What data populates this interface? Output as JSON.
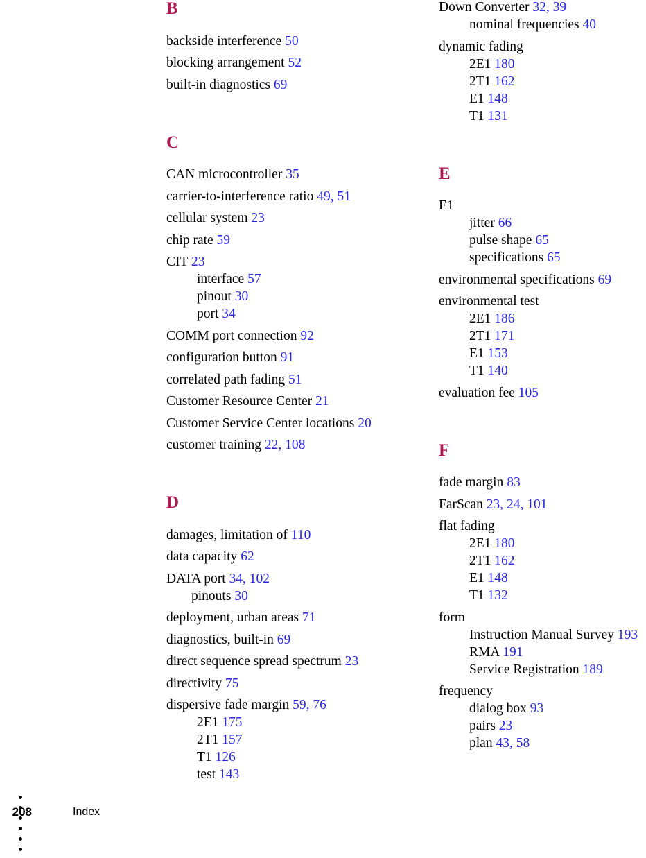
{
  "colors": {
    "letter_heading": "#AF1B53",
    "page_reference": "#2A28E2",
    "entry_text": "#000000",
    "background": "#FFFFFF"
  },
  "footer": {
    "page_number": "208",
    "section_label": "Index",
    "dot_count": 6
  },
  "columns": [
    {
      "id": "left",
      "sections": [
        {
          "letter": "B",
          "entries": [
            {
              "level": 0,
              "term": "backside interference",
              "pages": "50"
            },
            {
              "level": 0,
              "term": "blocking arrangement",
              "pages": "52"
            },
            {
              "level": 0,
              "term": "built-in diagnostics",
              "pages": "69"
            }
          ]
        },
        {
          "letter": "C",
          "entries": [
            {
              "level": 0,
              "term": "CAN microcontroller",
              "pages": "35"
            },
            {
              "level": 0,
              "term": "carrier-to-interference ratio",
              "pages": "49, 51"
            },
            {
              "level": 0,
              "term": "cellular system",
              "pages": "23"
            },
            {
              "level": 0,
              "term": "chip rate",
              "pages": "59"
            },
            {
              "level": 0,
              "term": "CIT",
              "pages": "23"
            },
            {
              "level": 1,
              "term": "interface",
              "pages": "57"
            },
            {
              "level": 1,
              "term": "pinout",
              "pages": "30"
            },
            {
              "level": 1,
              "term": "port",
              "pages": "34"
            },
            {
              "level": 0,
              "term": "COMM port connection",
              "pages": "92"
            },
            {
              "level": 0,
              "term": "configuration button",
              "pages": "91"
            },
            {
              "level": 0,
              "term": "correlated path fading",
              "pages": "51"
            },
            {
              "level": 0,
              "term": "Customer Resource Center",
              "pages": "21"
            },
            {
              "level": 0,
              "term": "Customer Service Center locations",
              "pages": "20"
            },
            {
              "level": 0,
              "term": "customer training",
              "pages": "22, 108"
            }
          ]
        },
        {
          "letter": "D",
          "entries": [
            {
              "level": 0,
              "term": "damages, limitation of",
              "pages": "110"
            },
            {
              "level": 0,
              "term": "data capacity",
              "pages": "62"
            },
            {
              "level": 0,
              "term": "DATA port",
              "pages": "34, 102"
            },
            {
              "level": 1,
              "term": "pinouts",
              "pages": "30",
              "indent": "sm"
            },
            {
              "level": 0,
              "term": "deployment, urban areas",
              "pages": "71"
            },
            {
              "level": 0,
              "term": "diagnostics, built-in",
              "pages": "69"
            },
            {
              "level": 0,
              "term": "direct sequence spread spectrum",
              "pages": "23"
            },
            {
              "level": 0,
              "term": "directivity",
              "pages": "75"
            },
            {
              "level": 0,
              "term": "dispersive fade margin",
              "pages": "59, 76"
            },
            {
              "level": 1,
              "term": "2E1",
              "pages": "175"
            },
            {
              "level": 1,
              "term": "2T1",
              "pages": "157"
            },
            {
              "level": 1,
              "term": "T1",
              "pages": "126"
            },
            {
              "level": 1,
              "term": "test",
              "pages": "143"
            }
          ]
        }
      ]
    },
    {
      "id": "right",
      "sections": [
        {
          "letter": "",
          "entries": [
            {
              "level": 0,
              "term": "Down Converter",
              "pages": "32, 39",
              "first": true
            },
            {
              "level": 1,
              "term": "nominal frequencies",
              "pages": "40",
              "indent": "deep"
            },
            {
              "level": 0,
              "term": "dynamic fading",
              "pages": ""
            },
            {
              "level": 1,
              "term": "2E1",
              "pages": "180"
            },
            {
              "level": 1,
              "term": "2T1",
              "pages": "162"
            },
            {
              "level": 1,
              "term": "E1",
              "pages": "148"
            },
            {
              "level": 1,
              "term": "T1",
              "pages": "131"
            }
          ]
        },
        {
          "letter": "E",
          "entries": [
            {
              "level": 0,
              "term": "E1",
              "pages": ""
            },
            {
              "level": 1,
              "term": "jitter",
              "pages": "66",
              "indent": "deep"
            },
            {
              "level": 1,
              "term": "pulse shape",
              "pages": "65",
              "indent": "deep"
            },
            {
              "level": 1,
              "term": "specifications",
              "pages": "65",
              "indent": "deep"
            },
            {
              "level": 0,
              "term": "environmental specifications",
              "pages": "69"
            },
            {
              "level": 0,
              "term": "environmental test",
              "pages": ""
            },
            {
              "level": 1,
              "term": "2E1",
              "pages": "186"
            },
            {
              "level": 1,
              "term": "2T1",
              "pages": "171"
            },
            {
              "level": 1,
              "term": "E1",
              "pages": "153"
            },
            {
              "level": 1,
              "term": "T1",
              "pages": "140"
            },
            {
              "level": 0,
              "term": "evaluation fee",
              "pages": "105"
            }
          ]
        },
        {
          "letter": "F",
          "entries": [
            {
              "level": 0,
              "term": "fade margin",
              "pages": "83"
            },
            {
              "level": 0,
              "term": "FarScan",
              "pages": "23, 24, 101"
            },
            {
              "level": 0,
              "term": "flat fading",
              "pages": ""
            },
            {
              "level": 1,
              "term": "2E1",
              "pages": "180"
            },
            {
              "level": 1,
              "term": "2T1",
              "pages": "162"
            },
            {
              "level": 1,
              "term": "E1",
              "pages": "148"
            },
            {
              "level": 1,
              "term": "T1",
              "pages": "132"
            },
            {
              "level": 0,
              "term": "form",
              "pages": ""
            },
            {
              "level": 1,
              "term": "Instruction Manual Survey",
              "pages": "193",
              "indent": "deep"
            },
            {
              "level": 1,
              "term": "RMA",
              "pages": "191",
              "indent": "deep"
            },
            {
              "level": 1,
              "term": "Service Registration",
              "pages": "189",
              "indent": "deep"
            },
            {
              "level": 0,
              "term": "frequency",
              "pages": ""
            },
            {
              "level": 1,
              "term": "dialog box",
              "pages": "93",
              "indent": "deep"
            },
            {
              "level": 1,
              "term": "pairs",
              "pages": "23",
              "indent": "deep"
            },
            {
              "level": 1,
              "term": "plan",
              "pages": "43, 58",
              "indent": "deep"
            }
          ]
        }
      ]
    }
  ]
}
